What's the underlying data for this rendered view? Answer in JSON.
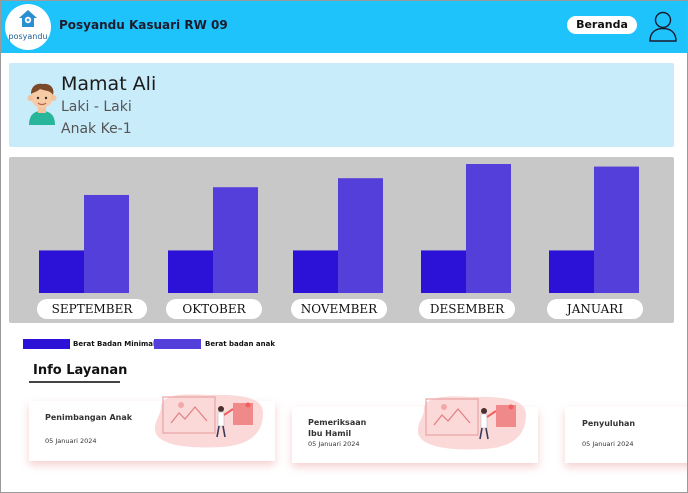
{
  "header": {
    "logo_text": "posyandu",
    "title": "Posyandu Kasuari RW 09",
    "nav_label": "Beranda",
    "user_icon": "user-outline-icon",
    "background": "#1ec3fb"
  },
  "profile": {
    "name": "Mamat Ali",
    "gender": "Laki - Laki",
    "child_order": "Anak Ke-1",
    "avatar_icon": "boy-avatar-icon",
    "background": "#c9ecfb"
  },
  "chart_data": {
    "type": "bar",
    "categories": [
      "SEPTEMBER",
      "OKTOBER",
      "NOVEMBER",
      "DESEMBER",
      "JANUARI"
    ],
    "series": [
      {
        "name": "Berat Badan Minimal",
        "values": [
          33,
          33,
          33,
          33,
          33
        ],
        "color": "#2b12d6"
      },
      {
        "name": "Berat badan anak",
        "values": [
          76,
          82,
          89,
          100,
          98
        ],
        "color": "#543fdb"
      }
    ],
    "ylim": [
      0,
      100
    ],
    "grid": false,
    "legend": "bottom-left",
    "title": "",
    "xlabel": "",
    "ylabel": ""
  },
  "services": {
    "section_title": "Info Layanan",
    "items": [
      {
        "title": "Penimbangan Anak",
        "date": "05 Januari 2024"
      },
      {
        "title": "Pemeriksaan Ibu Hamil",
        "date": "05 Januari 2024"
      },
      {
        "title": "Penyuluhan",
        "date": "05 Januari 2024"
      }
    ]
  }
}
